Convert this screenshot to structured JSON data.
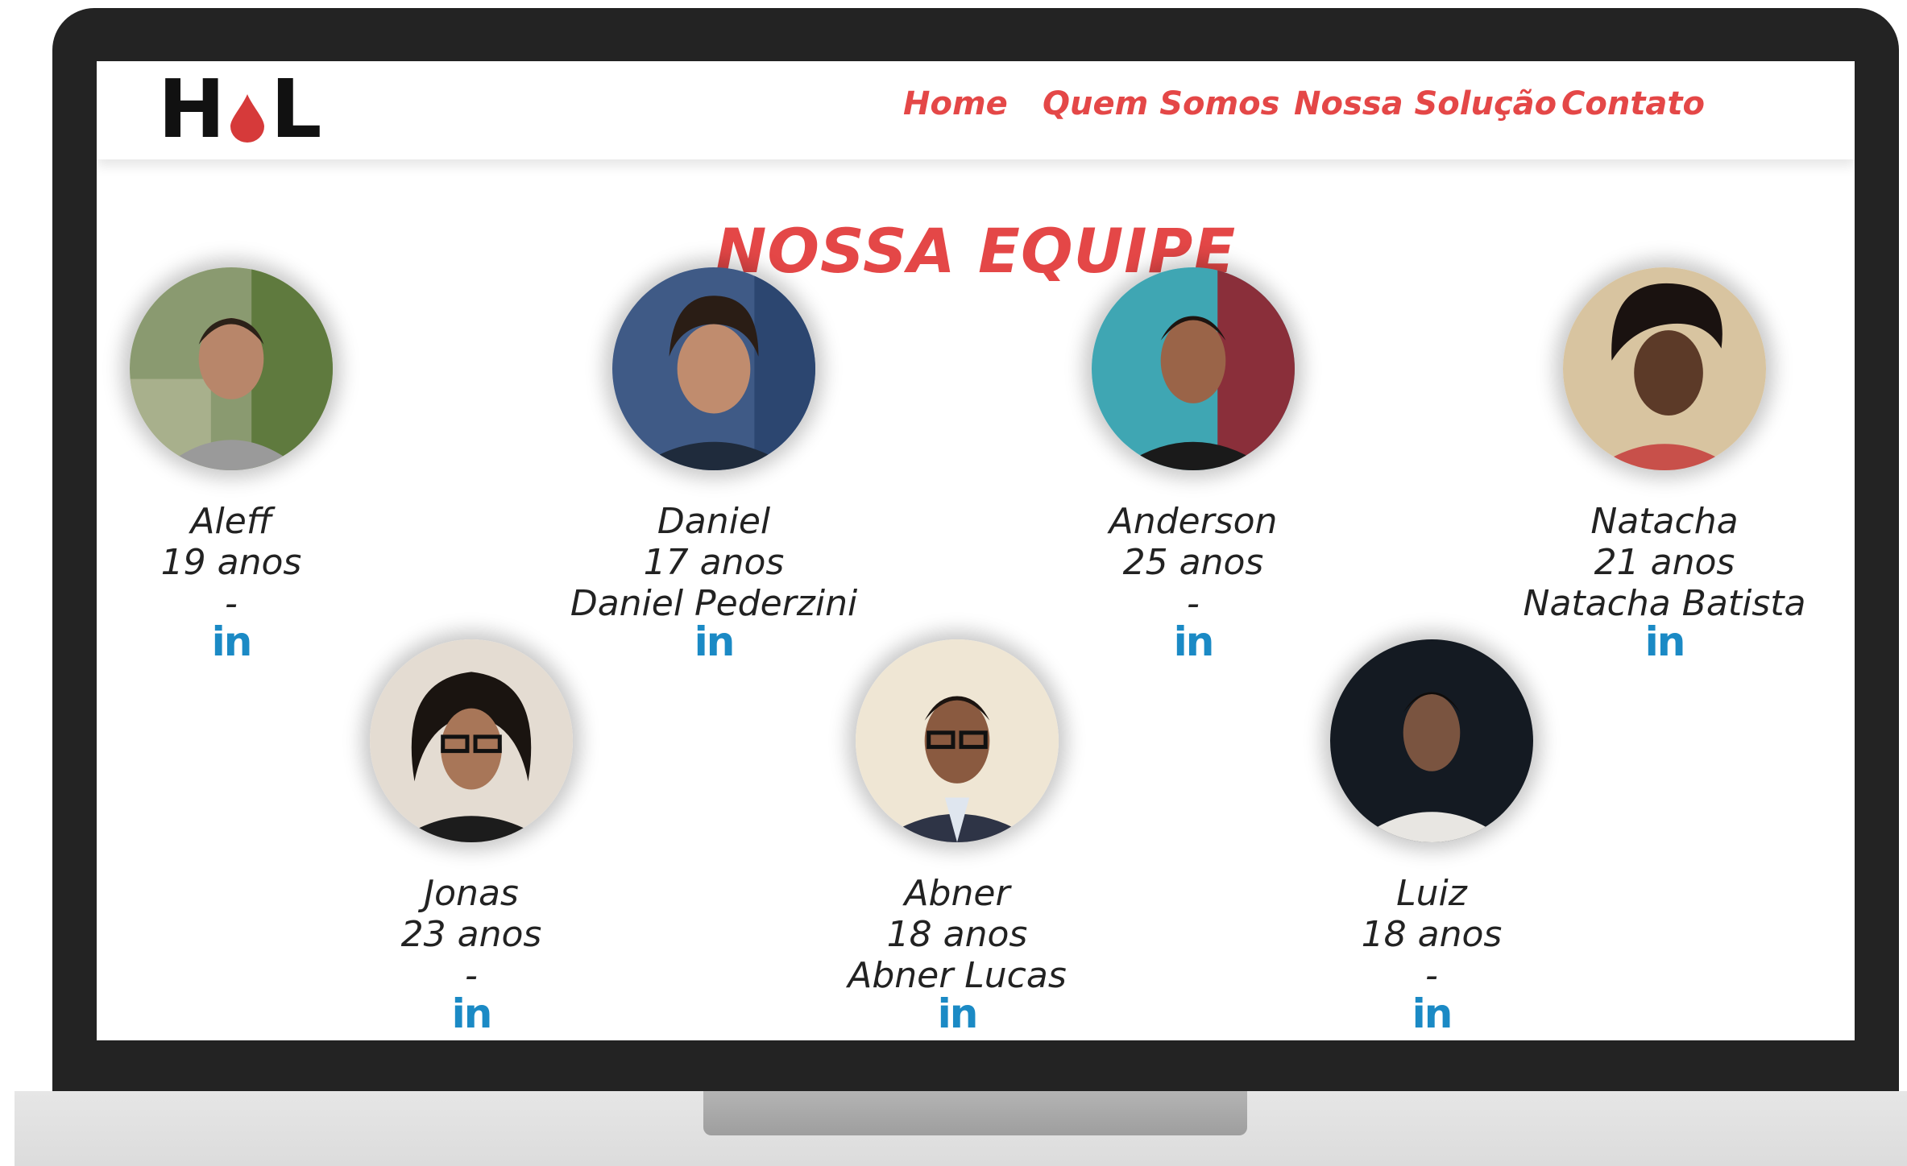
{
  "logo": {
    "left": "H",
    "right": "L"
  },
  "nav": {
    "home": "Home",
    "about": "Quem Somos",
    "solution": "Nossa Solução",
    "contact": "Contato"
  },
  "section_title": "NOSSA EQUIPE",
  "linkedin_label": "in",
  "members": [
    {
      "name": "Aleff",
      "age": "19 anos",
      "linkedin": "-"
    },
    {
      "name": "Daniel",
      "age": "17 anos",
      "linkedin": "Daniel Pederzini"
    },
    {
      "name": "Anderson",
      "age": "25 anos",
      "linkedin": "-"
    },
    {
      "name": "Natacha",
      "age": "21 anos",
      "linkedin": "Natacha Batista"
    },
    {
      "name": "Jonas",
      "age": "23 anos",
      "linkedin": "-"
    },
    {
      "name": "Abner",
      "age": "18 anos",
      "linkedin": "Abner Lucas"
    },
    {
      "name": "Luiz",
      "age": "18 anos",
      "linkedin": "-"
    }
  ],
  "colors": {
    "accent": "#e44747",
    "linkedin": "#1b8ac5",
    "bezel": "#232323",
    "text": "#222222"
  }
}
